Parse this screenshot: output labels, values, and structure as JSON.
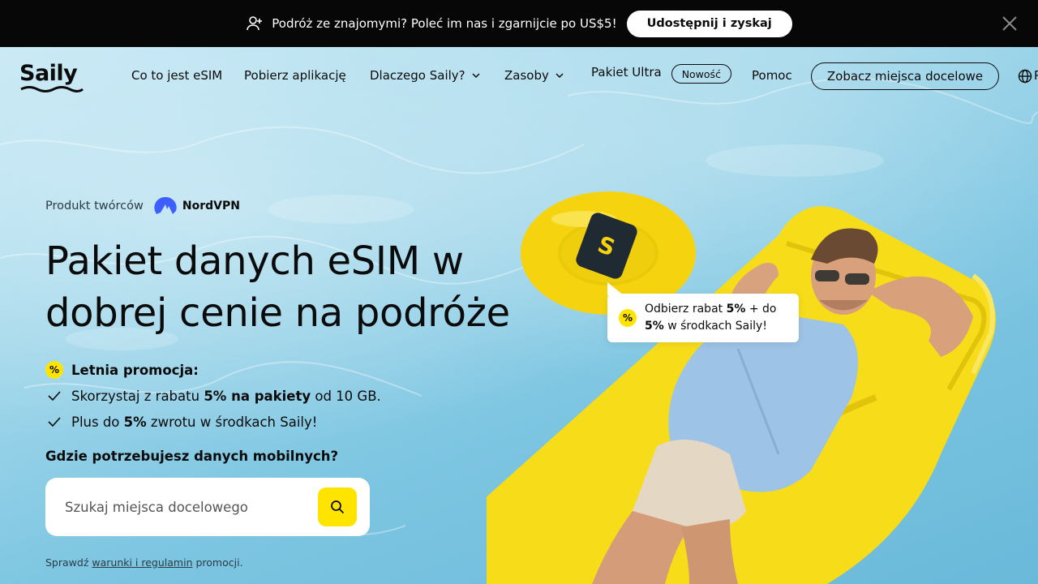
{
  "promo_bar": {
    "text": "Podróż ze znajomymi? Poleć im nas i zgarnijcie po US$5!",
    "button": "Udostępnij i zyskaj",
    "icons": {
      "referral": "add-user-icon",
      "close": "close-icon"
    }
  },
  "nav": {
    "logo": "Saily",
    "items": [
      {
        "label": "Co to jest eSIM"
      },
      {
        "label": "Pobierz aplikację"
      },
      {
        "label": "Dlaczego Saily?"
      },
      {
        "label": "Zasoby"
      },
      {
        "label": "Pakiet Ultra",
        "badge": "Nowość"
      },
      {
        "label": "Pomoc"
      }
    ],
    "cta": "Zobacz miejsca docelowe",
    "lang_partial": "P"
  },
  "hero": {
    "byline": "Produkt twórców",
    "brand": "NordVPN",
    "headline": "Pakiet danych eSIM w dobrej cenie na podróże",
    "promo_title": "Letnia promocja:",
    "promo_items": [
      {
        "pre": "Skorzystaj z rabatu ",
        "bold": "5% na pakiety",
        "post": " od 10 GB."
      },
      {
        "pre": "Plus do ",
        "bold": "5%",
        "post": " zwrotu w środkach Saily!"
      }
    ],
    "question": "Gdzie potrzebujesz danych mobilnych?",
    "search_placeholder": "Szukaj miejsca docelowego",
    "terms_pre": "Sprawdź ",
    "terms_link": "warunki i regulamin",
    "terms_post": " promocji."
  },
  "tooltip": {
    "pre": "Odbierz rabat ",
    "bold1": "5%",
    "mid": " + do",
    "bold2": "5%",
    "post": " w środkach Saily!"
  },
  "colors": {
    "accent": "#ffe400",
    "dark": "#070707",
    "water": "#8fcfe7"
  }
}
